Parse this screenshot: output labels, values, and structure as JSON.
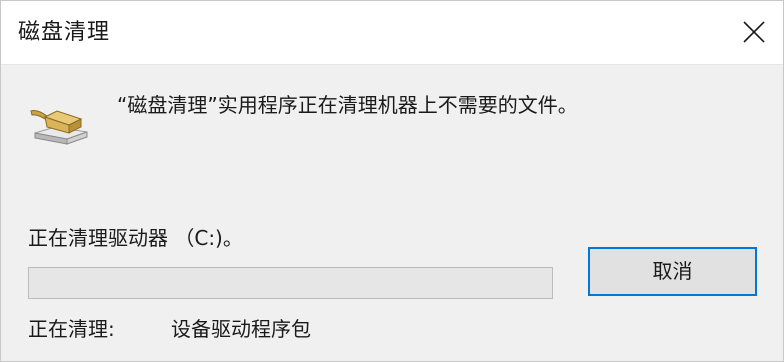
{
  "window": {
    "title": "磁盘清理"
  },
  "dialog": {
    "message": "“磁盘清理”实用程序正在清理机器上不需要的文件。",
    "drive_text": "正在清理驱动器 （C:)。",
    "progress_fraction": 0,
    "cancel_label": "取消",
    "status_label": "正在清理:",
    "status_value": "设备驱动程序包"
  },
  "icons": {
    "app": "disk-cleanup-broom-icon",
    "close": "close-icon"
  },
  "colors": {
    "accent": "#0078d7",
    "progress_fill": "#06b025",
    "dialog_bg": "#f0f0f0"
  }
}
